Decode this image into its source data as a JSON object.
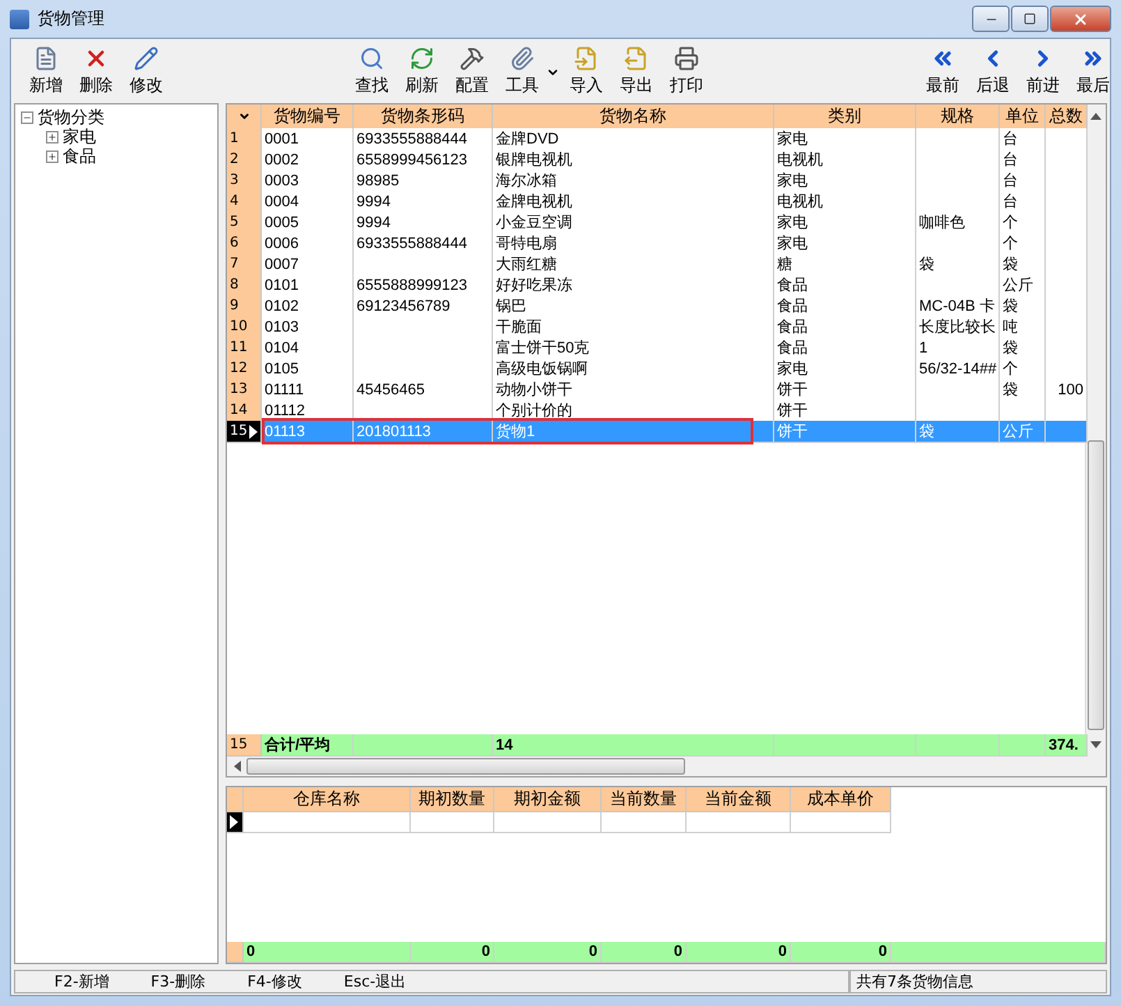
{
  "window": {
    "title": "货物管理"
  },
  "toolbar": {
    "groups": [
      [
        {
          "label": "新增"
        },
        {
          "label": "删除"
        },
        {
          "label": "修改"
        }
      ],
      [
        {
          "label": "查找"
        },
        {
          "label": "刷新"
        },
        {
          "label": "配置"
        },
        {
          "label": "工具",
          "has_menu": true
        },
        {
          "label": "导入"
        },
        {
          "label": "导出"
        },
        {
          "label": "打印"
        }
      ],
      [
        {
          "label": "最前"
        },
        {
          "label": "后退"
        },
        {
          "label": "前进"
        },
        {
          "label": "最后"
        }
      ]
    ]
  },
  "tree": [
    {
      "label": "货物分类",
      "expanded": true,
      "children": [
        {
          "label": "家电",
          "expanded": false
        },
        {
          "label": "食品",
          "expanded": false
        }
      ]
    }
  ],
  "goods_table": {
    "columns": [
      "货物编号",
      "货物条形码",
      "货物名称",
      "类别",
      "规格",
      "单位",
      "总数"
    ],
    "rows": [
      {
        "index": "1",
        "cells": [
          "0001",
          "6933555888444",
          "金牌DVD",
          "家电",
          "",
          "台",
          ""
        ],
        "selected": false
      },
      {
        "index": "2",
        "cells": [
          "0002",
          "6558999456123",
          "银牌电视机",
          "电视机",
          "",
          "台",
          ""
        ],
        "selected": false
      },
      {
        "index": "3",
        "cells": [
          "0003",
          "98985",
          "海尔冰箱",
          "家电",
          "",
          "台",
          ""
        ],
        "selected": false
      },
      {
        "index": "4",
        "cells": [
          "0004",
          "9994",
          "金牌电视机",
          "电视机",
          "",
          "台",
          ""
        ],
        "selected": false
      },
      {
        "index": "5",
        "cells": [
          "0005",
          "9994",
          "小金豆空调",
          "家电",
          "咖啡色",
          "个",
          ""
        ],
        "selected": false
      },
      {
        "index": "6",
        "cells": [
          "0006",
          "6933555888444",
          "哥特电扇",
          "家电",
          "",
          "个",
          ""
        ],
        "selected": false
      },
      {
        "index": "7",
        "cells": [
          "0007",
          "",
          "大雨红糖",
          "糖",
          "袋",
          "袋",
          ""
        ],
        "selected": false
      },
      {
        "index": "8",
        "cells": [
          "0101",
          "6555888999123",
          "好好吃果冻",
          "食品",
          "",
          "公斤",
          ""
        ],
        "selected": false
      },
      {
        "index": "9",
        "cells": [
          "0102",
          "69123456789",
          "锅巴",
          "食品",
          "MC-04B 卡",
          "袋",
          ""
        ],
        "selected": false
      },
      {
        "index": "10",
        "cells": [
          "0103",
          "",
          "干脆面",
          "食品",
          "长度比较长",
          "吨",
          ""
        ],
        "selected": false
      },
      {
        "index": "11",
        "cells": [
          "0104",
          "",
          "富士饼干50克",
          "食品",
          "1",
          "袋",
          ""
        ],
        "selected": false
      },
      {
        "index": "12",
        "cells": [
          "0105",
          "",
          "高级电饭锅啊",
          "家电",
          "56/32-14##",
          "个",
          ""
        ],
        "selected": false
      },
      {
        "index": "13",
        "cells": [
          "01111",
          "45456465",
          "动物小饼干",
          "饼干",
          "",
          "袋",
          "100"
        ],
        "selected": false
      },
      {
        "index": "14",
        "cells": [
          "01112",
          "",
          "个别计价的",
          "饼干",
          "",
          "",
          ""
        ],
        "selected": false
      },
      {
        "index": "15",
        "cells": [
          "01113",
          "201801113",
          "货物1",
          "饼干",
          "袋",
          "公斤",
          ""
        ],
        "selected": true,
        "highlighted": true
      }
    ],
    "summary": {
      "index": "15",
      "label": "合计/平均",
      "cells": [
        "",
        "14",
        "",
        "",
        "",
        "374."
      ]
    }
  },
  "stock_table": {
    "columns": [
      "仓库名称",
      "期初数量",
      "期初金额",
      "当前数量",
      "当前金额",
      "成本单价"
    ],
    "footer": [
      "0",
      "0",
      "0",
      "0",
      "0",
      "0"
    ]
  },
  "status_bar": {
    "shortcuts": [
      "F2-新增",
      "F3-删除",
      "F4-修改",
      "Esc-退出"
    ],
    "message": "共有7条货物信息"
  }
}
